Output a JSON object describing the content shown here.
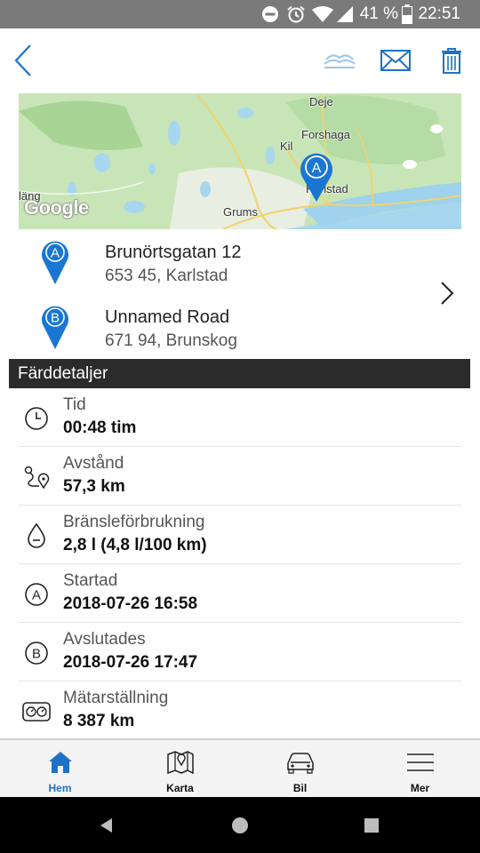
{
  "status_bar": {
    "battery_text": "41 %",
    "time": "22:51"
  },
  "map": {
    "places": [
      {
        "key": "deje",
        "name": "Deje"
      },
      {
        "key": "forshaga",
        "name": "Forshaga"
      },
      {
        "key": "kil",
        "name": "Kil"
      },
      {
        "key": "karlstad",
        "name": "Karlstad"
      },
      {
        "key": "grums",
        "name": "Grums"
      },
      {
        "key": "edge",
        "name": "läng"
      }
    ],
    "logo": "Google",
    "pin_letter": "A",
    "pin_color": "#1976d2"
  },
  "start": {
    "letter": "A",
    "street": "Brunörtsgatan 12",
    "city": "653 45, Karlstad"
  },
  "end": {
    "letter": "B",
    "street": "Unnamed Road",
    "city": "671 94, Brunskog"
  },
  "section_title": "Färddetaljer",
  "details": [
    {
      "icon": "clock-icon",
      "label": "Tid",
      "value": "00:48 tim"
    },
    {
      "icon": "route-icon",
      "label": "Avstånd",
      "value": "57,3 km"
    },
    {
      "icon": "fuel-drop-icon",
      "label": "Bränsleförbrukning",
      "value": "2,8 l (4,8 l/100 km)"
    },
    {
      "icon": "letter-a-icon",
      "label": "Startad",
      "value": "2018-07-26 16:58"
    },
    {
      "icon": "letter-b-icon",
      "label": "Avslutades",
      "value": "2018-07-26 17:47"
    },
    {
      "icon": "odometer-icon",
      "label": "Mätarställning",
      "value": "8 387 km"
    }
  ],
  "nav": [
    {
      "key": "home",
      "label": "Hem",
      "active": true
    },
    {
      "key": "map",
      "label": "Karta",
      "active": false
    },
    {
      "key": "car",
      "label": "Bil",
      "active": false
    },
    {
      "key": "more",
      "label": "Mer",
      "active": false
    }
  ],
  "colors": {
    "accent": "#1d72c8",
    "pin": "#1976d2",
    "header_bg": "#2b2b2b"
  }
}
